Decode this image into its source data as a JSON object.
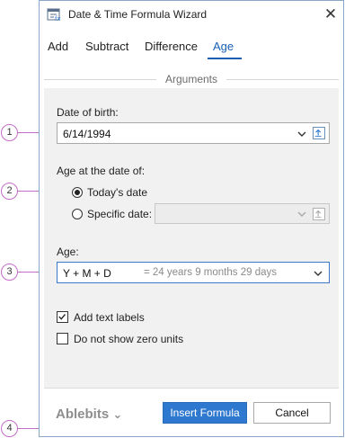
{
  "window": {
    "title": "Date & Time Formula Wizard",
    "close_glyph": "✕"
  },
  "tabs": [
    {
      "label": "Add",
      "active": false
    },
    {
      "label": "Subtract",
      "active": false
    },
    {
      "label": "Difference",
      "active": false
    },
    {
      "label": "Age",
      "active": true
    }
  ],
  "arguments": {
    "group_title": "Arguments",
    "date_of_birth": {
      "label": "Date of birth:",
      "value": "6/14/1994"
    },
    "age_at": {
      "label": "Age at the date of:",
      "options": [
        {
          "label": "Today's date",
          "selected": true
        },
        {
          "label": "Specific date:",
          "selected": false
        }
      ],
      "specific_date_value": ""
    },
    "age": {
      "label": "Age:",
      "value": "Y + M + D",
      "hint": "= 24 years 9 months 29 days"
    },
    "checkboxes": [
      {
        "label": "Add text labels",
        "checked": true
      },
      {
        "label": "Do not show zero units",
        "checked": false
      }
    ]
  },
  "footer": {
    "brand": "Ablebits",
    "brand_chevron": "⌄",
    "insert_label": "Insert Formula",
    "cancel_label": "Cancel"
  },
  "callouts": [
    "1",
    "2",
    "3",
    "4"
  ],
  "colors": {
    "accent": "#2f78cf",
    "callout": "#c36bc8",
    "panel_bg": "#f1f1f1"
  }
}
